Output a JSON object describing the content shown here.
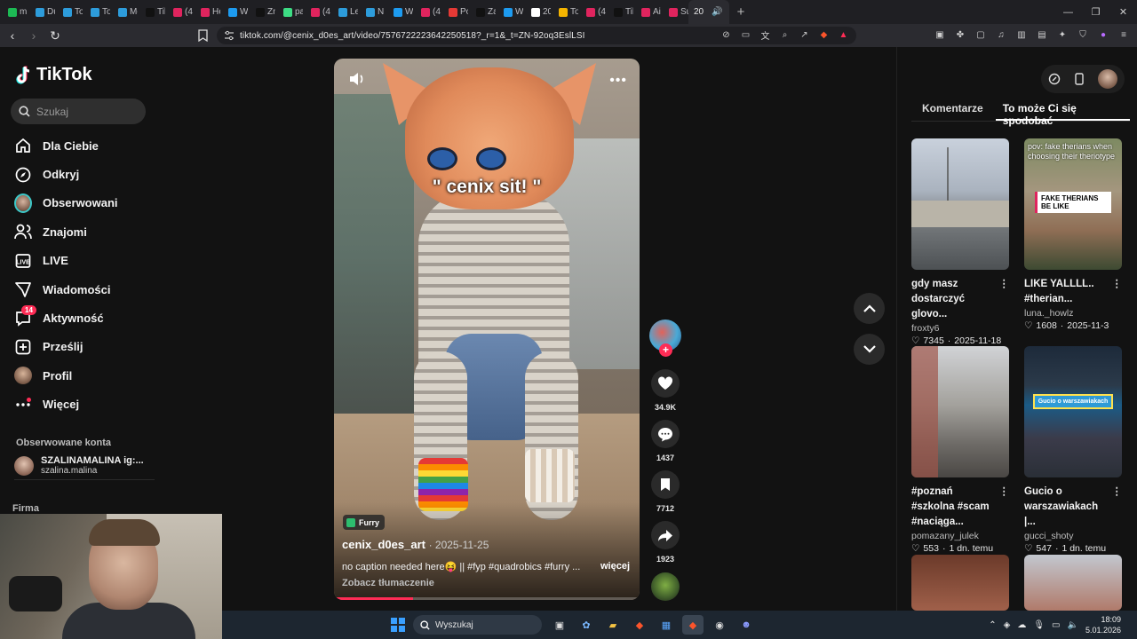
{
  "browser": {
    "tabs": [
      {
        "label": "mi",
        "color": "#1db954"
      },
      {
        "label": "Du",
        "color": "#2d9cdb"
      },
      {
        "label": "To",
        "color": "#2d9cdb"
      },
      {
        "label": "To",
        "color": "#2d9cdb"
      },
      {
        "label": "Me",
        "color": "#2d9cdb"
      },
      {
        "label": "Tik",
        "color": "#111111"
      },
      {
        "label": "(4",
        "color": "#e0245e"
      },
      {
        "label": "He",
        "color": "#e0245e"
      },
      {
        "label": "W",
        "color": "#1d9bf0"
      },
      {
        "label": "Zn",
        "color": "#111111"
      },
      {
        "label": "pa",
        "color": "#3ddc84"
      },
      {
        "label": "(4",
        "color": "#e0245e"
      },
      {
        "label": "Le",
        "color": "#2d9cdb"
      },
      {
        "label": "N",
        "color": "#2d9cdb"
      },
      {
        "label": "W",
        "color": "#1d9bf0"
      },
      {
        "label": "(4",
        "color": "#e0245e"
      },
      {
        "label": "Po",
        "color": "#e53935"
      },
      {
        "label": "Za",
        "color": "#111111"
      },
      {
        "label": "W",
        "color": "#1d9bf0"
      },
      {
        "label": "20",
        "color": "#ffffff"
      },
      {
        "label": "To",
        "color": "#f4b400"
      },
      {
        "label": "(4",
        "color": "#e0245e"
      },
      {
        "label": "Tik",
        "color": "#111111"
      },
      {
        "label": "Air",
        "color": "#e0245e"
      },
      {
        "label": "Su",
        "color": "#e0245e"
      }
    ],
    "active_tab": {
      "label": "20"
    },
    "url": "tiktok.com/@cenix_d0es_art/video/7576722223642250518?_r=1&_t=ZN-92oq3EslLSI"
  },
  "sidebar": {
    "brand": "TikTok",
    "search_placeholder": "Szukaj",
    "nav": [
      {
        "label": "Dla Ciebie",
        "icon": "home-icon"
      },
      {
        "label": "Odkryj",
        "icon": "compass-icon"
      },
      {
        "label": "Obserwowani",
        "icon": "following-avatar-icon"
      },
      {
        "label": "Znajomi",
        "icon": "friends-icon"
      },
      {
        "label": "LIVE",
        "icon": "live-icon"
      },
      {
        "label": "Wiadomości",
        "icon": "messages-icon"
      },
      {
        "label": "Aktywność",
        "icon": "activity-icon",
        "badge": "14"
      },
      {
        "label": "Prześlij",
        "icon": "upload-icon"
      },
      {
        "label": "Profil",
        "icon": "profile-avatar-icon"
      },
      {
        "label": "Więcej",
        "icon": "more-icon"
      }
    ],
    "followed_title": "Obserwowane konta",
    "followed_account": {
      "name": "SZALINAMALINA ig:...",
      "handle": "szalina.malina"
    },
    "company_label": "Firma"
  },
  "video": {
    "overlay_text": "\" cenix sit! \"",
    "tag": "Furry",
    "author": "cenix_d0es_art",
    "date": "· 2025-11-25",
    "description": "no caption needed here😝  || #fyp #quadrobics #furry ...",
    "more_label": "więcej",
    "translate_label": "Zobacz tłumaczenie",
    "progress": 0.26
  },
  "actions": {
    "likes": "34.9K",
    "comments": "1437",
    "saves": "7712",
    "shares": "1923"
  },
  "right_panel": {
    "tabs": [
      "Komentarze",
      "To może Ci się spodobać"
    ],
    "cards": [
      {
        "title": "gdy masz dostarczyć glovo...",
        "user": "froxty6",
        "likes": "7345",
        "date": "2025-11-18"
      },
      {
        "title": "LIKE YALLLL.. #therian...",
        "user": "luna._howlz",
        "likes": "1608",
        "date": "2025-11-3",
        "thumb_top": "pov: fake therians when choosing their theriotype",
        "thumb_caption": "FAKE THERIANS BE LIKE"
      },
      {
        "title": "#poznań #szkolna #scam #naciąga...",
        "user": "pomazany_julek",
        "likes": "553",
        "date": "1 dn. temu"
      },
      {
        "title": "Gucio o warszawiakach |...",
        "user": "gucci_shoty",
        "likes": "547",
        "date": "1 dn. temu",
        "thumb_caption": "Gucio o warszawiakach"
      }
    ]
  },
  "taskbar": {
    "search_placeholder": "Wyszukaj",
    "time": "18:09",
    "date": "5.01.2026"
  },
  "colors": {
    "accent": "#fe2c55",
    "background": "#121212"
  }
}
